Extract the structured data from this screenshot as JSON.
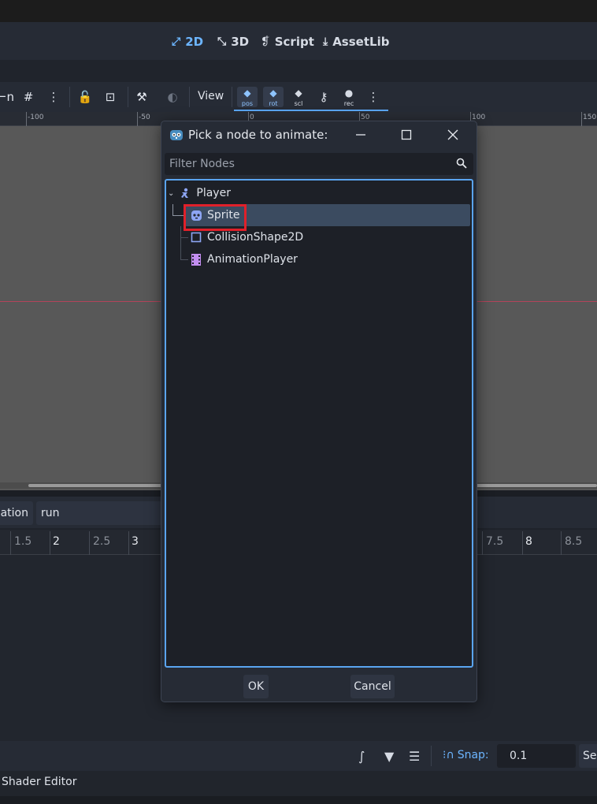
{
  "workspaces": {
    "items": [
      {
        "label": "2D",
        "icon": "2d-icon",
        "active": true
      },
      {
        "label": "3D",
        "icon": "3d-icon"
      },
      {
        "label": "Script",
        "icon": "script-icon"
      },
      {
        "label": "AssetLib",
        "icon": "assetlib-icon"
      }
    ]
  },
  "toolbar": {
    "view_label": "View",
    "key_labels": [
      "pos",
      "rot",
      "scl",
      "rec"
    ]
  },
  "ruler": {
    "ticks": [
      "-100",
      "-50",
      "0",
      "50",
      "100",
      "150"
    ]
  },
  "animation": {
    "label": "nation",
    "selected": "run"
  },
  "timeline": {
    "marks": [
      "1.5",
      "2",
      "2.5",
      "3",
      "7.5",
      "8",
      "8.5"
    ]
  },
  "bottom": {
    "snap_label": "Snap:",
    "snap_value": "0.1",
    "unit_label": "Se"
  },
  "status": {
    "shader_editor": "Shader Editor"
  },
  "dialog": {
    "title": "Pick a node to animate:",
    "filter_placeholder": "Filter Nodes",
    "nodes": [
      {
        "name": "Player",
        "icon": "character-body-icon"
      },
      {
        "name": "Sprite",
        "icon": "sprite-icon",
        "selected": true
      },
      {
        "name": "CollisionShape2D",
        "icon": "collision-shape-icon"
      },
      {
        "name": "AnimationPlayer",
        "icon": "animation-player-icon"
      }
    ],
    "ok_label": "OK",
    "cancel_label": "Cancel"
  },
  "colors": {
    "accent": "#5aa4f0",
    "highlight_box": "#e0202a",
    "selection": "#3b4b60"
  }
}
